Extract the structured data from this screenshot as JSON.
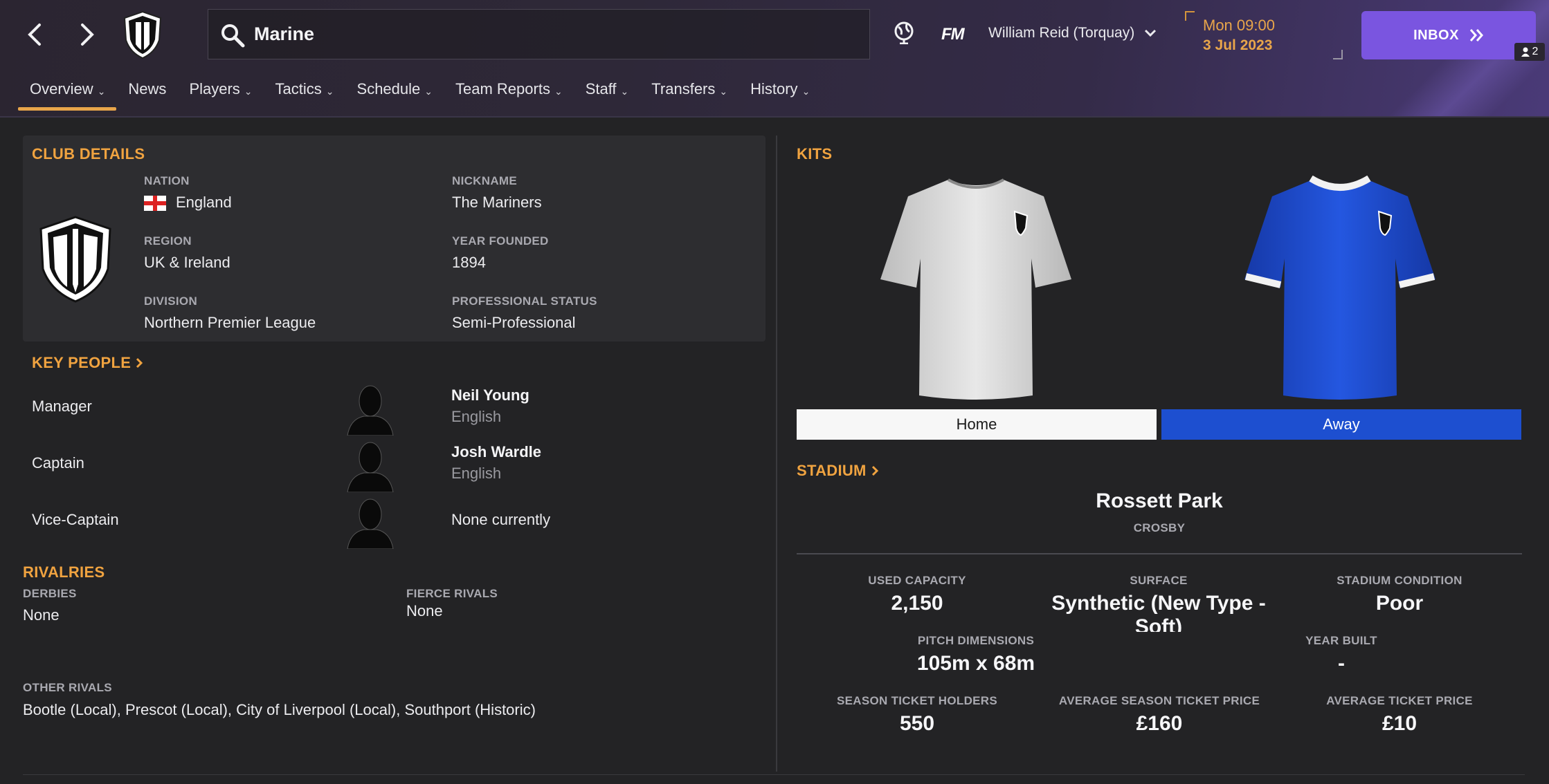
{
  "header": {
    "search_value": "Marine",
    "fm_logo": "FM",
    "manager": "William Reid (Torquay)",
    "time": "Mon 09:00",
    "date": "3 Jul 2023",
    "inbox_label": "INBOX",
    "inbox_count": "2",
    "accent_color": "#7a55e0"
  },
  "tabs": [
    {
      "label": "Overview",
      "active": true
    },
    {
      "label": "News"
    },
    {
      "label": "Players"
    },
    {
      "label": "Tactics"
    },
    {
      "label": "Schedule"
    },
    {
      "label": "Team Reports"
    },
    {
      "label": "Staff"
    },
    {
      "label": "Transfers"
    },
    {
      "label": "History"
    }
  ],
  "club_details": {
    "title": "CLUB DETAILS",
    "nation_label": "NATION",
    "nation": "England",
    "nickname_label": "NICKNAME",
    "nickname": "The Mariners",
    "region_label": "REGION",
    "region": "UK & Ireland",
    "year_founded_label": "YEAR FOUNDED",
    "year_founded": "1894",
    "division_label": "DIVISION",
    "division": "Northern Premier League",
    "status_label": "PROFESSIONAL STATUS",
    "status": "Semi-Professional"
  },
  "key_people": {
    "title": "KEY PEOPLE",
    "people": [
      {
        "role": "Manager",
        "name": "Neil Young",
        "nationality": "English"
      },
      {
        "role": "Captain",
        "name": "Josh Wardle",
        "nationality": "English"
      },
      {
        "role": "Vice-Captain",
        "name": "",
        "nationality": "",
        "none": "None currently"
      }
    ]
  },
  "rivalries": {
    "title": "RIVALRIES",
    "derbies_label": "DERBIES",
    "derbies": "None",
    "fierce_label": "FIERCE RIVALS",
    "fierce": "None",
    "other_label": "OTHER RIVALS",
    "other": "Bootle (Local), Prescot (Local), City of Liverpool (Local), Southport (Historic)"
  },
  "kits": {
    "title": "KITS",
    "home_label": "Home",
    "away_label": "Away",
    "home_color": "#dcdcdc",
    "away_color": "#1d4fd0"
  },
  "stadium": {
    "title": "STADIUM",
    "name": "Rossett Park",
    "location": "CROSBY",
    "used_capacity_label": "USED CAPACITY",
    "used_capacity": "2,150",
    "surface_label": "SURFACE",
    "surface": "Synthetic (New Type - Soft)",
    "condition_label": "STADIUM CONDITION",
    "condition": "Poor",
    "pitch_label": "PITCH DIMENSIONS",
    "pitch": "105m x 68m",
    "year_built_label": "YEAR BUILT",
    "year_built": "-",
    "season_holders_label": "SEASON TICKET HOLDERS",
    "season_holders": "550",
    "avg_season_price_label": "AVERAGE SEASON TICKET PRICE",
    "avg_season_price": "£160",
    "avg_ticket_label": "AVERAGE TICKET PRICE",
    "avg_ticket": "£10"
  }
}
